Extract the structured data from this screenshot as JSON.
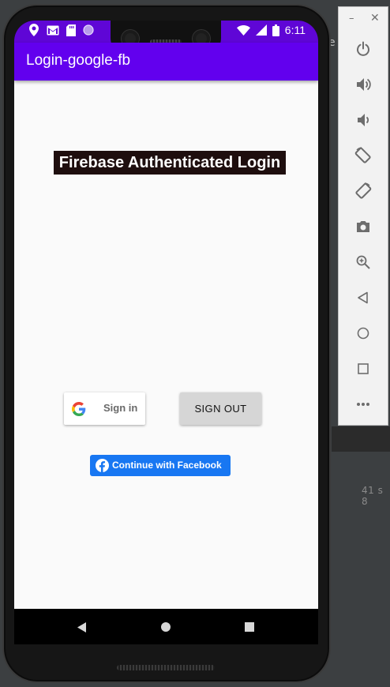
{
  "status_bar": {
    "time": "6:11",
    "left_icons": [
      "location-icon",
      "gmail-icon",
      "sd-card-icon",
      "sync-icon"
    ],
    "right_icons": [
      "wifi-icon",
      "signal-icon",
      "battery-icon"
    ]
  },
  "app_bar": {
    "title": "Login-google-fb",
    "color": "#6200ee",
    "status_color": "#5f06d6"
  },
  "main": {
    "heading": "Firebase Authenticated Login",
    "google_button_label": "Sign in",
    "sign_out_label": "SIGN OUT",
    "facebook_button_label": "Continue with Facebook",
    "facebook_color": "#1877f2"
  },
  "nav_bar": {
    "buttons": [
      "back-icon",
      "home-icon",
      "recent-apps-icon"
    ]
  },
  "emulator_toolbar": {
    "window_controls": [
      "minimize-icon",
      "close-icon"
    ],
    "buttons": [
      "power-icon",
      "volume-up-icon",
      "volume-down-icon",
      "rotate-left-icon",
      "rotate-right-icon",
      "camera-icon",
      "zoom-icon",
      "back-icon",
      "home-icon",
      "overview-icon",
      "more-icon"
    ]
  },
  "ide": {
    "partial_text": "41 s 8"
  }
}
